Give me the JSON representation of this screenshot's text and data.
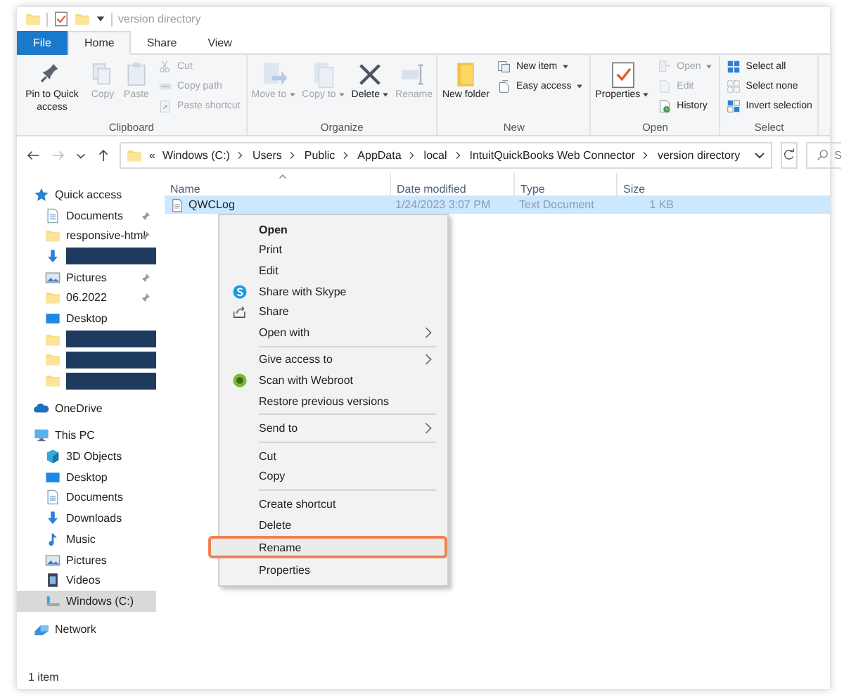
{
  "window": {
    "title": "version directory"
  },
  "ribbon_tabs": [
    {
      "label": "File",
      "kind": "file",
      "selected": false
    },
    {
      "label": "Home",
      "kind": "tab",
      "selected": true
    },
    {
      "label": "Share",
      "kind": "tab",
      "selected": false
    },
    {
      "label": "View",
      "kind": "tab",
      "selected": false
    }
  ],
  "ribbon": {
    "groups": [
      {
        "label": "Clipboard",
        "buttons": [
          {
            "label": "Pin to Quick access",
            "kind": "pin",
            "disabled": false,
            "dropdown": false
          },
          {
            "label": "Copy",
            "kind": "copy",
            "disabled": true,
            "dropdown": false
          },
          {
            "label": "Paste",
            "kind": "paste",
            "disabled": true,
            "dropdown": false
          }
        ],
        "small_buttons": [
          {
            "label": "Cut",
            "kind": "cut",
            "disabled": true,
            "dropdown": false
          },
          {
            "label": "Copy path",
            "kind": "copypath",
            "disabled": true,
            "dropdown": false
          },
          {
            "label": "Paste shortcut",
            "kind": "pasteshortcut",
            "disabled": true,
            "dropdown": false
          }
        ]
      },
      {
        "label": "Organize",
        "buttons": [
          {
            "label": "Move to",
            "kind": "moveto",
            "disabled": true,
            "dropdown": true
          },
          {
            "label": "Copy to",
            "kind": "copyto",
            "disabled": true,
            "dropdown": true
          },
          {
            "label": "Delete",
            "kind": "delete",
            "disabled": false,
            "dropdown": true
          },
          {
            "label": "Rename",
            "kind": "rename",
            "disabled": true,
            "dropdown": false
          }
        ]
      },
      {
        "label": "New",
        "buttons": [
          {
            "label": "New folder",
            "kind": "newfolder",
            "disabled": false,
            "dropdown": false
          }
        ],
        "small_buttons": [
          {
            "label": "New item",
            "kind": "newitem",
            "disabled": false,
            "dropdown": true
          },
          {
            "label": "Easy access",
            "kind": "easyaccess",
            "disabled": false,
            "dropdown": true
          }
        ]
      },
      {
        "label": "Open",
        "buttons": [
          {
            "label": "Properties",
            "kind": "properties",
            "disabled": false,
            "dropdown": true
          }
        ],
        "small_buttons": [
          {
            "label": "Open",
            "kind": "open",
            "disabled": true,
            "dropdown": true
          },
          {
            "label": "Edit",
            "kind": "edit",
            "disabled": true,
            "dropdown": false
          },
          {
            "label": "History",
            "kind": "history",
            "disabled": false,
            "dropdown": false
          }
        ]
      },
      {
        "label": "Select",
        "small_buttons": [
          {
            "label": "Select all",
            "kind": "selectall",
            "disabled": false,
            "dropdown": false
          },
          {
            "label": "Select none",
            "kind": "selectnone",
            "disabled": false,
            "dropdown": false
          },
          {
            "label": "Invert selection",
            "kind": "invert",
            "disabled": false,
            "dropdown": false
          }
        ]
      }
    ]
  },
  "address_bar": {
    "overflow_mark": "«",
    "path": [
      "Windows (C:)",
      "Users",
      "Public",
      "AppData",
      "local",
      "IntuitQuickBooks Web Connector",
      "version directory"
    ]
  },
  "search": {
    "placeholder": "S"
  },
  "nav_pane": {
    "items": [
      {
        "label": "Quick access",
        "kind": "star",
        "selected": false,
        "children": [
          {
            "label": "Documents",
            "kind": "docs",
            "pinned": true,
            "redacted": false,
            "selected": false
          },
          {
            "label": "responsive-html",
            "kind": "folder",
            "pinned": true,
            "redacted": false,
            "selected": false
          },
          {
            "kind": "download",
            "pinned": false,
            "redacted": true,
            "selected": false
          },
          {
            "label": "Pictures",
            "kind": "pictures",
            "pinned": true,
            "redacted": false,
            "selected": false
          },
          {
            "label": "06.2022",
            "kind": "folder",
            "pinned": true,
            "redacted": false,
            "selected": false
          },
          {
            "label": "Desktop",
            "kind": "desktop",
            "pinned": false,
            "redacted": false,
            "selected": false
          },
          {
            "kind": "folder",
            "pinned": false,
            "redacted": true,
            "selected": false
          },
          {
            "kind": "folder",
            "pinned": false,
            "redacted": true,
            "selected": false
          },
          {
            "kind": "folder",
            "pinned": false,
            "redacted": true,
            "selected": false
          }
        ]
      },
      {
        "label": "OneDrive",
        "kind": "cloud",
        "selected": false
      },
      {
        "label": "This PC",
        "kind": "pc",
        "selected": false,
        "children": [
          {
            "label": "3D Objects",
            "kind": "cube",
            "selected": false
          },
          {
            "label": "Desktop",
            "kind": "desktop",
            "selected": false
          },
          {
            "label": "Documents",
            "kind": "docs",
            "selected": false
          },
          {
            "label": "Downloads",
            "kind": "download",
            "selected": false
          },
          {
            "label": "Music",
            "kind": "music",
            "selected": false
          },
          {
            "label": "Pictures",
            "kind": "pictures",
            "selected": false
          },
          {
            "label": "Videos",
            "kind": "videos",
            "selected": false
          },
          {
            "label": "Windows (C:)",
            "kind": "drive",
            "selected": true
          }
        ]
      },
      {
        "label": "Network",
        "kind": "network",
        "selected": false
      }
    ]
  },
  "file_list": {
    "columns": [
      {
        "label": "Name",
        "sorted": true
      },
      {
        "label": "Date modified",
        "sorted": false
      },
      {
        "label": "Type",
        "sorted": false
      },
      {
        "label": "Size",
        "sorted": false
      }
    ],
    "rows": [
      {
        "cells": [
          "QWCLog",
          "1/24/2023 3:07 PM",
          "Text Document",
          "1 KB"
        ],
        "selected": true
      }
    ]
  },
  "context_menu": {
    "groups": [
      [
        {
          "label": "Open",
          "kind": "plain",
          "default": true,
          "submenu": false,
          "highlighted": false
        },
        {
          "label": "Print",
          "kind": "plain",
          "default": false,
          "submenu": false,
          "highlighted": false
        },
        {
          "label": "Edit",
          "kind": "plain",
          "default": false,
          "submenu": false,
          "highlighted": false
        },
        {
          "label": "Share with Skype",
          "kind": "skype",
          "default": false,
          "submenu": false,
          "highlighted": false
        },
        {
          "label": "Share",
          "kind": "share",
          "default": false,
          "submenu": false,
          "highlighted": false
        },
        {
          "label": "Open with",
          "kind": "plain",
          "default": false,
          "submenu": true,
          "highlighted": false
        }
      ],
      [
        {
          "label": "Give access to",
          "kind": "plain",
          "default": false,
          "submenu": true,
          "highlighted": false
        },
        {
          "label": "Scan with Webroot",
          "kind": "webroot",
          "default": false,
          "submenu": false,
          "highlighted": false
        },
        {
          "label": "Restore previous versions",
          "kind": "plain",
          "default": false,
          "submenu": false,
          "highlighted": false
        }
      ],
      [
        {
          "label": "Send to",
          "kind": "plain",
          "default": false,
          "submenu": true,
          "highlighted": false
        }
      ],
      [
        {
          "label": "Cut",
          "kind": "plain",
          "default": false,
          "submenu": false,
          "highlighted": false
        },
        {
          "label": "Copy",
          "kind": "plain",
          "default": false,
          "submenu": false,
          "highlighted": false
        }
      ],
      [
        {
          "label": "Create shortcut",
          "kind": "plain",
          "default": false,
          "submenu": false,
          "highlighted": false
        },
        {
          "label": "Delete",
          "kind": "plain",
          "default": false,
          "submenu": false,
          "highlighted": false
        },
        {
          "label": "Rename",
          "kind": "plain",
          "default": false,
          "submenu": false,
          "highlighted": true
        },
        {
          "label": "Properties",
          "kind": "plain",
          "default": false,
          "submenu": false,
          "highlighted": false
        }
      ]
    ]
  },
  "status_bar": {
    "text": "1 item"
  }
}
